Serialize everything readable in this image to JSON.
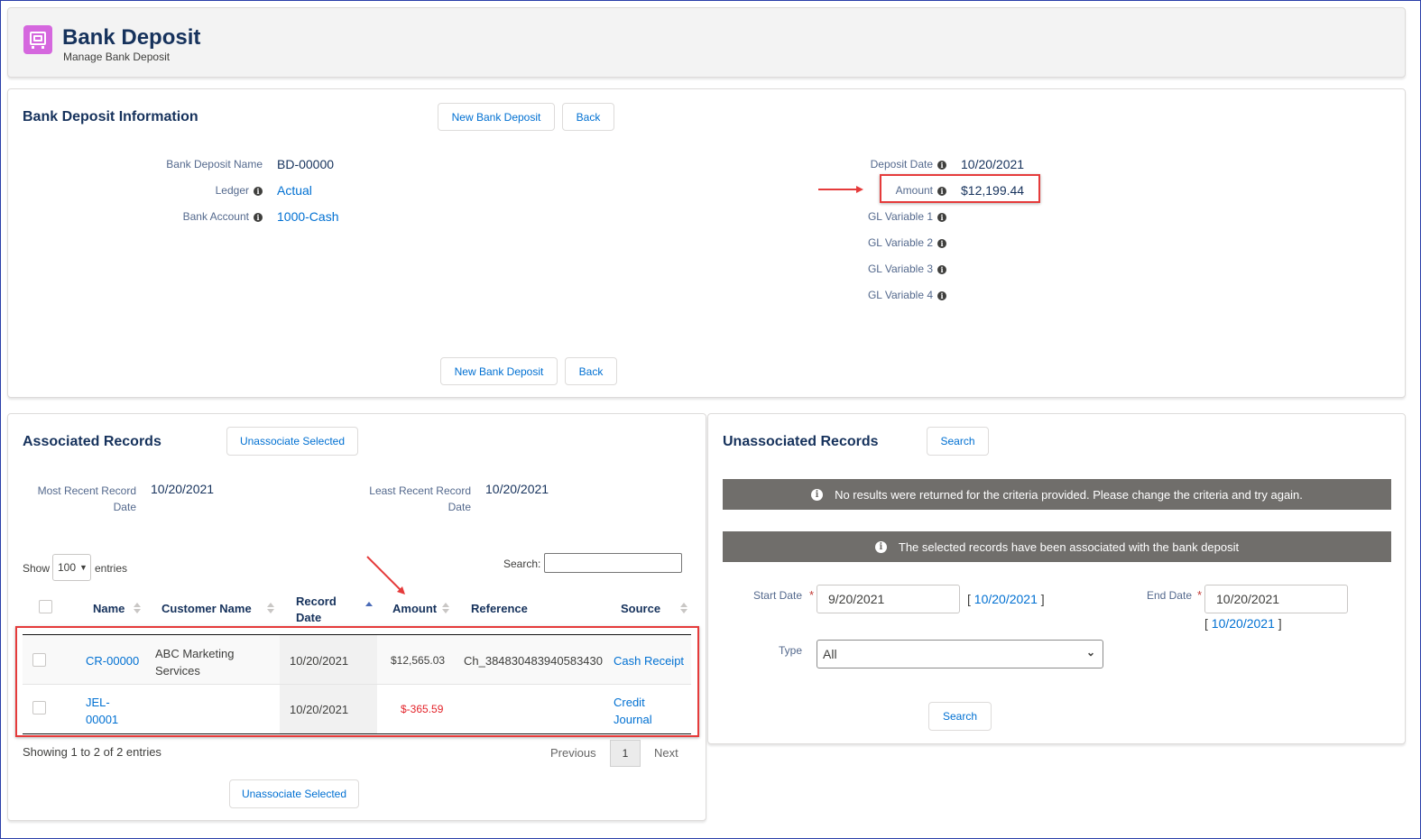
{
  "header": {
    "title": "Bank Deposit",
    "subtitle": "Manage Bank Deposit",
    "icon": "bank-deposit-icon",
    "icon_color": "#d567de"
  },
  "info": {
    "title": "Bank Deposit Information",
    "new_button": "New Bank Deposit",
    "back_button": "Back",
    "fields_left": [
      {
        "label": "Bank Deposit Name",
        "value": "BD-00000",
        "info": false,
        "link": false
      },
      {
        "label": "Ledger",
        "value": "Actual",
        "info": true,
        "link": true
      },
      {
        "label": "Bank Account",
        "value": "1000-Cash",
        "info": true,
        "link": true
      }
    ],
    "fields_right": [
      {
        "label": "Deposit Date",
        "value": "10/20/2021"
      },
      {
        "label": "Amount",
        "value": "$12,199.44"
      },
      {
        "label": "GL Variable 1",
        "value": ""
      },
      {
        "label": "GL Variable 2",
        "value": ""
      },
      {
        "label": "GL Variable 3",
        "value": ""
      },
      {
        "label": "GL Variable 4",
        "value": ""
      }
    ],
    "info_glyph": "i"
  },
  "associated": {
    "title": "Associated Records",
    "unassociate_button": "Unassociate Selected",
    "most_recent_label": "Most Recent Record Date",
    "most_recent_label_l1": "Most Recent Record",
    "most_recent_label_l2": "Date",
    "most_recent_value": "10/20/2021",
    "least_recent_label_l1": "Least Recent Record",
    "least_recent_label_l2": "Date",
    "least_recent_value": "10/20/2021",
    "show_label": "Show",
    "show_value": "100",
    "entries_label": "entries",
    "search_label": "Search:",
    "columns": [
      "Name",
      "Customer Name",
      "Record Date",
      "Amount",
      "Reference",
      "Source"
    ],
    "col_record_l1": "Record",
    "col_record_l2": "Date",
    "rows": [
      {
        "name": "CR-00000",
        "customer_l1": "ABC Marketing",
        "customer_l2": "Services",
        "date": "10/20/2021",
        "amount": "$12,565.03",
        "reference": "Ch_384830483940583430",
        "source": "Cash Receipt"
      },
      {
        "name_l1": "JEL-",
        "name_l2": "00001",
        "date": "10/20/2021",
        "amount": "$-365.59",
        "reference": "",
        "source_l1": "Credit",
        "source_l2": "Journal"
      }
    ],
    "showing": "Showing 1 to 2 of 2 entries",
    "previous": "Previous",
    "page": "1",
    "next": "Next",
    "negative_color": "#e3242b"
  },
  "unassociated": {
    "title": "Unassociated Records",
    "search_button": "Search",
    "notice1": "No results were returned for the criteria provided. Please change the criteria and try again.",
    "notice2": "The selected records have been associated with the bank deposit",
    "start_date_label": "Start Date",
    "start_date_value": "9/20/2021",
    "start_date_link": "10/20/2021",
    "end_date_label": "End Date",
    "end_date_value": "10/20/2021",
    "end_date_link": "10/20/2021",
    "bracket_open": "[",
    "bracket_close": "]",
    "required_mark": "*",
    "type_label": "Type",
    "type_value": "All",
    "search_bottom": "Search"
  },
  "annotation_color": "#e53b3b"
}
